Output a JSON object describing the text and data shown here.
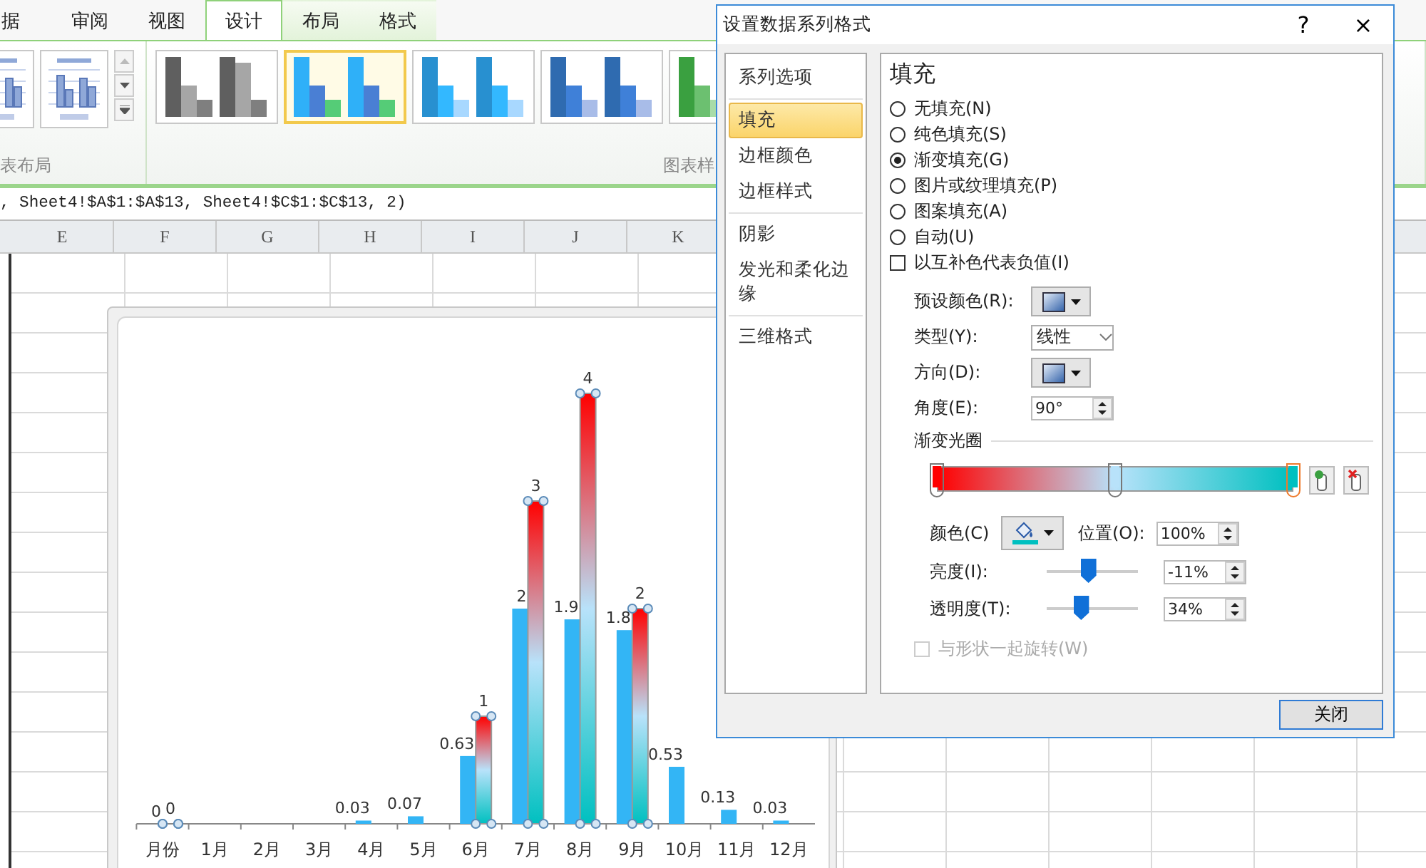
{
  "ribbon": {
    "tabs": [
      {
        "label": "据",
        "selected": false,
        "contextual": false
      },
      {
        "label": "审阅",
        "selected": false,
        "contextual": false
      },
      {
        "label": "视图",
        "selected": false,
        "contextual": false
      },
      {
        "label": "设计",
        "selected": true,
        "contextual": true
      },
      {
        "label": "布局",
        "selected": false,
        "contextual": true
      },
      {
        "label": "格式",
        "selected": false,
        "contextual": true
      }
    ],
    "layout_group_label": "表布局",
    "chart_styles": [
      {
        "selected": false,
        "kind": "gray"
      },
      {
        "selected": true,
        "kind": "mixed"
      },
      {
        "selected": false,
        "kind": "cyan"
      },
      {
        "selected": false,
        "kind": "blue"
      },
      {
        "selected": false,
        "kind": "green"
      }
    ],
    "styles_group_label": "图表样"
  },
  "formula_bar": {
    "text": ", Sheet4!$A$1:$A$13, Sheet4!$C$1:$C$13, 2)"
  },
  "columns": [
    "E",
    "F",
    "G",
    "H",
    "I",
    "J",
    "K"
  ],
  "chart": {
    "chart_data": {
      "type": "bar",
      "categories": [
        "月份",
        "1月",
        "2月",
        "3月",
        "4月",
        "5月",
        "6月",
        "7月",
        "8月",
        "9月",
        "10月",
        "11月",
        "12月"
      ],
      "series": [
        {
          "color": "#33b5f5",
          "values": [
            0,
            null,
            null,
            null,
            0.03,
            0.07,
            0.63,
            2,
            1.9,
            1.8,
            0.53,
            0.13,
            0.03
          ]
        },
        {
          "values": [
            0,
            null,
            null,
            null,
            null,
            null,
            1,
            3,
            4,
            2,
            null,
            null,
            null
          ]
        }
      ],
      "data_labels": true
    },
    "series_selected": [
      false,
      true
    ]
  },
  "dialog": {
    "title": "设置数据系列格式",
    "help": "?",
    "close": "×",
    "nav": [
      {
        "items": [
          {
            "label": "系列选项",
            "selected": false
          }
        ]
      },
      {
        "items": [
          {
            "label": "填充",
            "selected": true
          },
          {
            "label": "边框颜色",
            "selected": false
          },
          {
            "label": "边框样式",
            "selected": false
          }
        ]
      },
      {
        "items": [
          {
            "label": "阴影",
            "selected": false
          },
          {
            "label": "发光和柔化边缘",
            "selected": false
          }
        ]
      },
      {
        "items": [
          {
            "label": "三维格式",
            "selected": false
          }
        ]
      }
    ],
    "heading": "填充",
    "fill_options": [
      {
        "label": "无填充(N)",
        "selected": false
      },
      {
        "label": "纯色填充(S)",
        "selected": false
      },
      {
        "label": "渐变填充(G)",
        "selected": true
      },
      {
        "label": "图片或纹理填充(P)",
        "selected": false
      },
      {
        "label": "图案填充(A)",
        "selected": false
      },
      {
        "label": "自动(U)",
        "selected": false
      }
    ],
    "invert_checkbox": {
      "label": "以互补色代表负值(I)",
      "checked": false
    },
    "preset_color": {
      "label": "预设颜色(R):"
    },
    "type": {
      "label": "类型(Y):",
      "value": "线性"
    },
    "direction": {
      "label": "方向(D):"
    },
    "angle": {
      "label": "角度(E):",
      "value": "90°"
    },
    "stops_label": "渐变光圈",
    "gradient_stops": [
      {
        "level": 0,
        "color": "#ff0000",
        "selected": false
      },
      {
        "level": 0.5,
        "color": "#b8e2fa",
        "selected": false
      },
      {
        "level": 1,
        "color": "#00c0c0",
        "selected": true
      }
    ],
    "color": {
      "label": "颜色(C)"
    },
    "position": {
      "label": "位置(O):",
      "value": "100%"
    },
    "brightness": {
      "label": "亮度(I):",
      "value": "-11%",
      "level": 0.45
    },
    "transparency": {
      "label": "透明度(T):",
      "value": "34%",
      "level": 0.37
    },
    "rotate_checkbox": {
      "label": "与形状一起旋转(W)",
      "checked": false,
      "disabled": true
    },
    "close_button": "关闭"
  }
}
